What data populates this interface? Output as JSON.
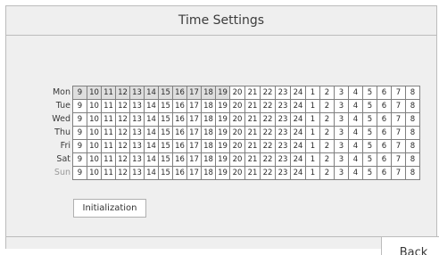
{
  "window": {
    "title": "Time Settings"
  },
  "schedule": {
    "days": [
      {
        "label": "Mon",
        "dimmed": false
      },
      {
        "label": "Tue",
        "dimmed": false
      },
      {
        "label": "Wed",
        "dimmed": false
      },
      {
        "label": "Thu",
        "dimmed": false
      },
      {
        "label": "Fri",
        "dimmed": false
      },
      {
        "label": "Sat",
        "dimmed": false
      },
      {
        "label": "Sun",
        "dimmed": true
      }
    ],
    "hours": [
      "9",
      "10",
      "11",
      "12",
      "13",
      "14",
      "15",
      "16",
      "17",
      "18",
      "19",
      "20",
      "21",
      "22",
      "23",
      "24",
      "1",
      "2",
      "3",
      "4",
      "5",
      "6",
      "7",
      "8"
    ],
    "highlighted_hour_indices": [
      0,
      1,
      2,
      3,
      4,
      5,
      6,
      7,
      8,
      9,
      10
    ],
    "highlight_color": "#dedede"
  },
  "buttons": {
    "initialization": "Initialization",
    "back": "Back"
  }
}
